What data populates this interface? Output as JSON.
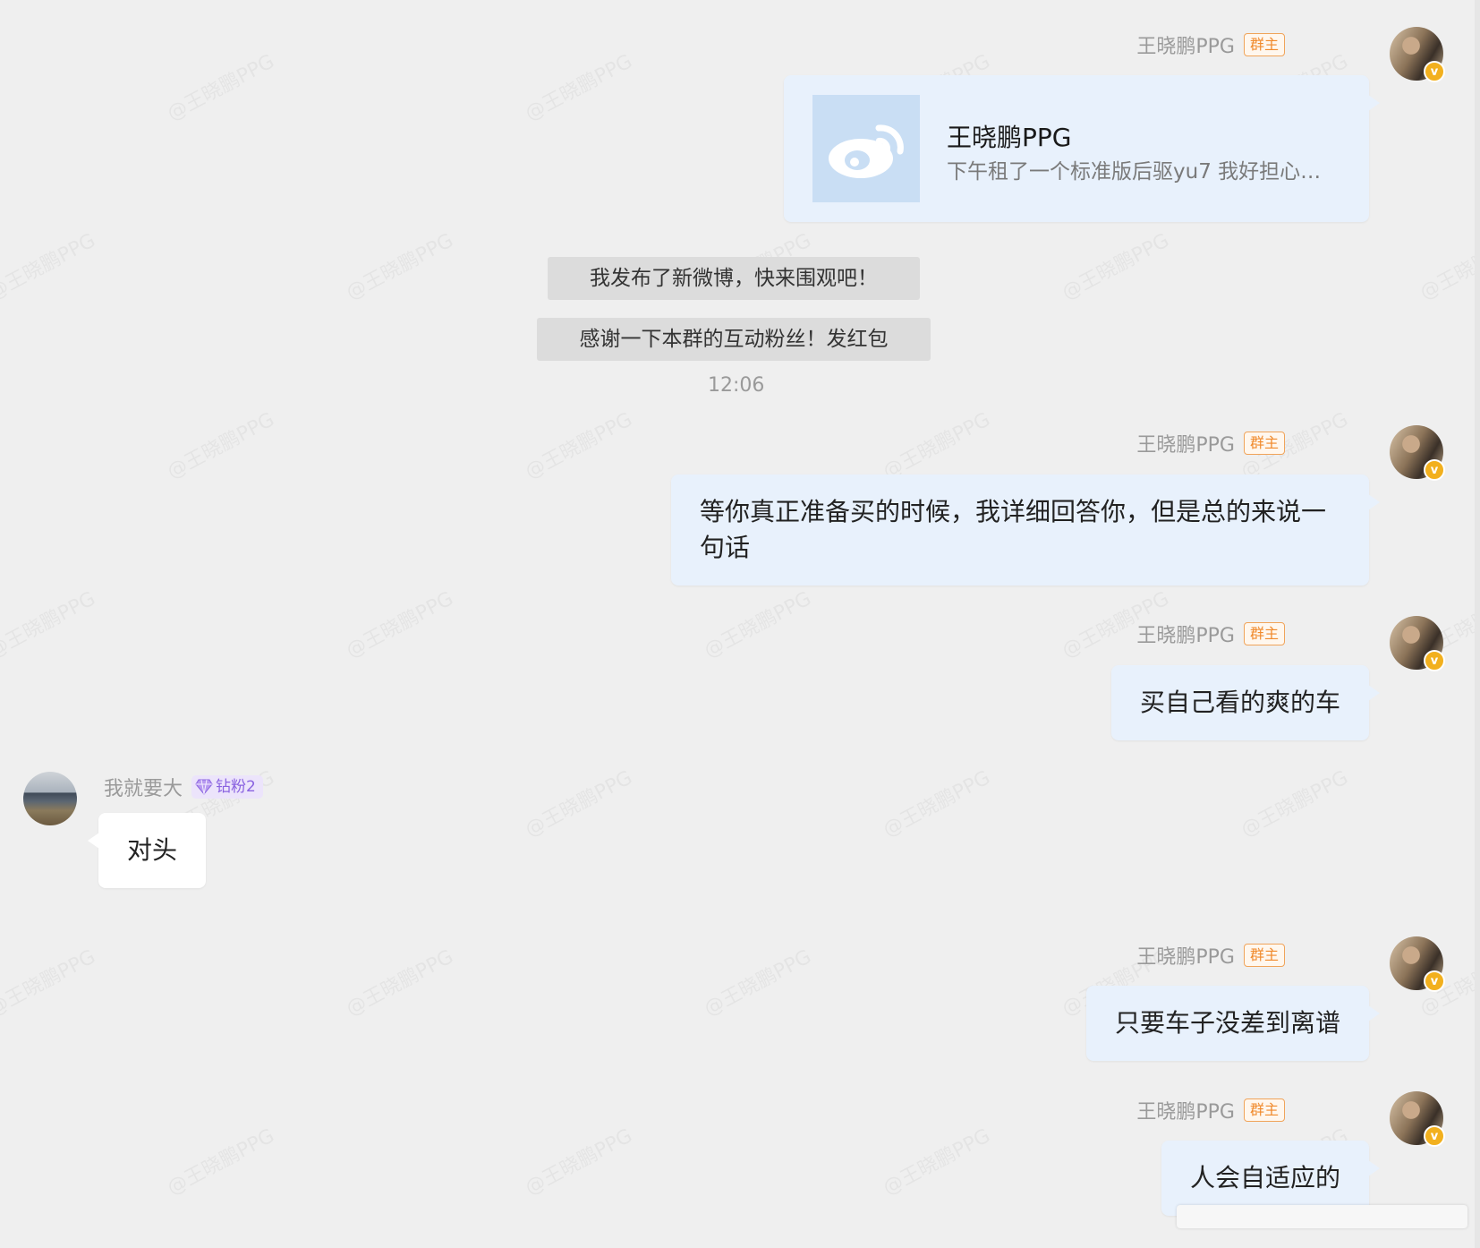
{
  "watermark_text": "@王晓鹏PPG",
  "messages": {
    "m1": {
      "sender": "王晓鹏PPG",
      "badge": "群主",
      "share_title": "王晓鹏PPG",
      "share_desc": "下午租了一个标准版后驱yu7 我好担心…"
    },
    "sys1": "我发布了新微博，快来围观吧！",
    "sys2": "感谢一下本群的互动粉丝！发红包",
    "time1": "12:06",
    "m2": {
      "sender": "王晓鹏PPG",
      "badge": "群主",
      "text_line1": "等你真正准备买的时候，我详细回答你，但是总的来说一",
      "text_line2": "句话"
    },
    "m3": {
      "sender": "王晓鹏PPG",
      "badge": "群主",
      "text": "买自己看的爽的车"
    },
    "m4": {
      "sender": "我就要大",
      "badge": "钻粉2",
      "text": "对头"
    },
    "m5": {
      "sender": "王晓鹏PPG",
      "badge": "群主",
      "text": "只要车子没差到离谱"
    },
    "m6": {
      "sender": "王晓鹏PPG",
      "badge": "群主",
      "text": "人会自适应的"
    }
  },
  "icons": {
    "verified": "v",
    "diamond": "diamond-icon",
    "weibo": "weibo-logo-icon"
  },
  "colors": {
    "background": "#efefef",
    "bubble_self": "#e8f1fc",
    "bubble_other": "#ffffff",
    "owner_badge": "#f08a2c",
    "fan_badge": "#8a63e0",
    "verified": "#f2b01e"
  }
}
